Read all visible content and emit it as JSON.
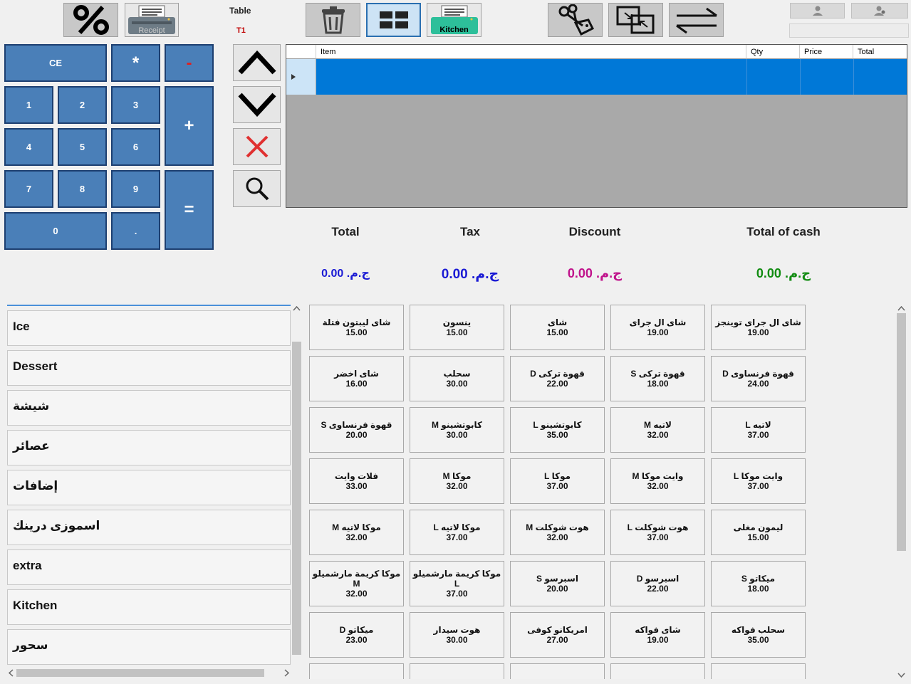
{
  "toolbar": {
    "receipt_label": "Receipt",
    "table_label": "Table",
    "table_value": "T1",
    "kitchen_label": "Kitchen"
  },
  "keypad": {
    "ce": "CE",
    "mul": "*",
    "minus": "-",
    "plus": "+",
    "equals": "=",
    "d1": "1",
    "d2": "2",
    "d3": "3",
    "d4": "4",
    "d5": "5",
    "d6": "6",
    "d7": "7",
    "d8": "8",
    "d9": "9",
    "d0": "0",
    "dot": "."
  },
  "grid": {
    "columns": [
      "Item",
      "Qty",
      "Price",
      "Total"
    ]
  },
  "totals": {
    "total_label": "Total",
    "tax_label": "Tax",
    "discount_label": "Discount",
    "cash_label": "Total of cash",
    "total_value": "ج.م. 0.00",
    "tax_value": "ج.م. 0.00",
    "discount_value": "ج.م. 0.00",
    "cash_value": "ج.م. 0.00",
    "total_color": "#1a1ad4",
    "tax_color": "#1a1ad4",
    "discount_color": "#c0148c",
    "cash_color": "#128c12"
  },
  "categories": [
    "Ice",
    "Dessert",
    "شيشة",
    "عصائر",
    "إضافات",
    "اسموزى درينك",
    "extra",
    "Kitchen",
    "سحور"
  ],
  "products": [
    {
      "name": "شاى ال جراى توينجز",
      "price": "19.00"
    },
    {
      "name": "شاى ال جراى",
      "price": "19.00"
    },
    {
      "name": "شاى",
      "price": "15.00"
    },
    {
      "name": "ينسون",
      "price": "15.00"
    },
    {
      "name": "شاى ليبتون فتلة",
      "price": "15.00"
    },
    {
      "name": "قهوة فرنساوى D",
      "price": "24.00"
    },
    {
      "name": "قهوة تركى S",
      "price": "18.00"
    },
    {
      "name": "قهوة تركى D",
      "price": "22.00"
    },
    {
      "name": "سحلب",
      "price": "30.00"
    },
    {
      "name": "شاى اخضر",
      "price": "16.00"
    },
    {
      "name": "لاتيه L",
      "price": "37.00"
    },
    {
      "name": "لاتيه M",
      "price": "32.00"
    },
    {
      "name": "كابوتشينو L",
      "price": "35.00"
    },
    {
      "name": "كابوتشينو M",
      "price": "30.00"
    },
    {
      "name": "قهوة فرنساوى S",
      "price": "20.00"
    },
    {
      "name": "وايت موكا L",
      "price": "37.00"
    },
    {
      "name": "وايت موكا M",
      "price": "32.00"
    },
    {
      "name": "موكا L",
      "price": "37.00"
    },
    {
      "name": "موكا M",
      "price": "32.00"
    },
    {
      "name": "فلات وايت",
      "price": "33.00"
    },
    {
      "name": "ليمون مغلى",
      "price": "15.00"
    },
    {
      "name": "هوت شوكلت L",
      "price": "37.00"
    },
    {
      "name": "هوت شوكلت M",
      "price": "32.00"
    },
    {
      "name": "موكا لاتيه L",
      "price": "37.00"
    },
    {
      "name": "موكا لاتيه M",
      "price": "32.00"
    },
    {
      "name": "ميكاتو S",
      "price": "18.00"
    },
    {
      "name": "اسبرسو D",
      "price": "22.00"
    },
    {
      "name": "اسبرسو S",
      "price": "20.00"
    },
    {
      "name": "موكا كريمة مارشميلو L",
      "price": "37.00"
    },
    {
      "name": "موكا كريمة مارشميلو M",
      "price": "32.00"
    },
    {
      "name": "سحلب فواكه",
      "price": "35.00"
    },
    {
      "name": "شاى فواكه",
      "price": "19.00"
    },
    {
      "name": "امريكانو كوفى",
      "price": "27.00"
    },
    {
      "name": "هوت سيدار",
      "price": "30.00"
    },
    {
      "name": "ميكاتو D",
      "price": "23.00"
    }
  ],
  "colors": {
    "keypad_bg": "#4a7fb8",
    "grid_selection": "#0078d7",
    "grid_bg": "#a9a9a9"
  }
}
